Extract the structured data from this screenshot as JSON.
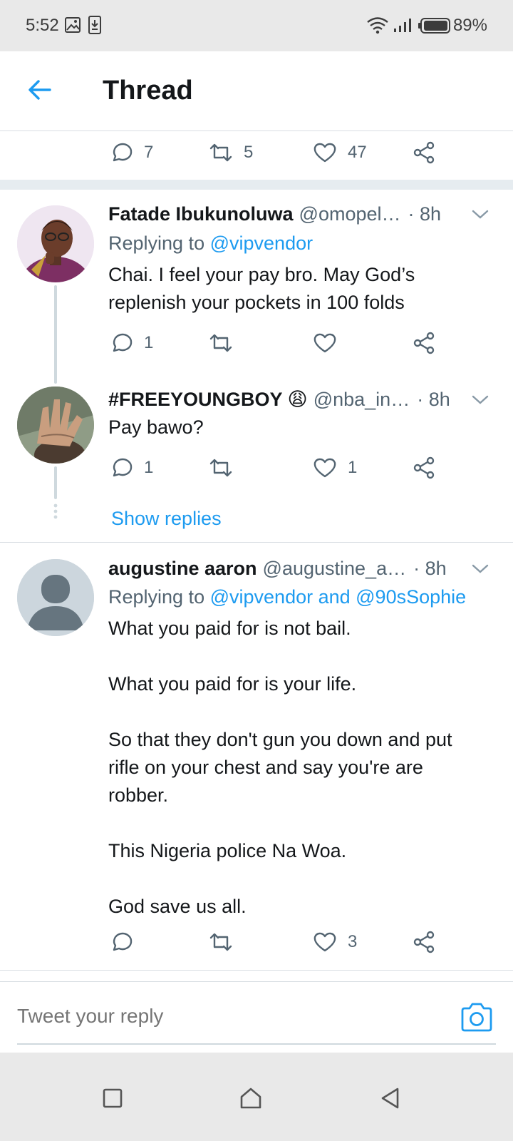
{
  "status_bar": {
    "time": "5:52",
    "battery": "89%",
    "icons": [
      "image-icon",
      "download-icon",
      "wifi-icon",
      "signal-icon",
      "battery-icon"
    ]
  },
  "header": {
    "title": "Thread",
    "back_icon": "back-arrow-icon"
  },
  "top_actions": {
    "replies": "7",
    "retweets": "5",
    "likes": "47"
  },
  "tweets": [
    {
      "name": "Fatade Ibukunoluwa",
      "handle": "@omopel…",
      "time": "· 8h",
      "replying_prefix": "Replying to",
      "replying_to": "@vipvendor",
      "text": "Chai. I feel your pay bro. May God’s\nreplenish your pockets in 100 folds",
      "replies": "1",
      "retweets": "",
      "likes": ""
    },
    {
      "name": "#FREEYOUNGBOY 😩",
      "handle": "@nba_in…",
      "time": "· 8h",
      "text": "Pay bawo?",
      "replies": "1",
      "retweets": "",
      "likes": "1",
      "show_replies": "Show replies"
    },
    {
      "name": "augustine aaron",
      "handle": "@augustine_a…",
      "time": "· 8h",
      "replying_prefix": "Replying to",
      "replying_to": "@vipvendor and @90sSophie",
      "text": "What you paid for is not bail.\n\nWhat you paid for is your life.\n\nSo that they don't gun you down and put\nrifle on your chest and say you're are\nrobber.\n\nThis Nigeria police Na Woa.\n\nGod save us all.",
      "replies": "",
      "retweets": "",
      "likes": "3"
    }
  ],
  "composer": {
    "placeholder": "Tweet your reply"
  },
  "colors": {
    "accent": "#1d9bf0",
    "text_primary": "#14171a",
    "text_secondary": "#536471",
    "divider": "#e6ecf0"
  }
}
